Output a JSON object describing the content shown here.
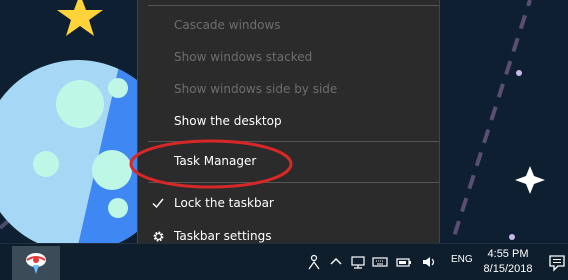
{
  "context_menu": {
    "items": [
      {
        "label": "Cascade windows",
        "enabled": false
      },
      {
        "label": "Show windows stacked",
        "enabled": false
      },
      {
        "label": "Show windows side by side",
        "enabled": false
      },
      {
        "label": "Show the desktop",
        "enabled": true
      },
      {
        "label": "Task Manager",
        "enabled": true,
        "highlighted": true
      },
      {
        "label": "Lock the taskbar",
        "enabled": true,
        "checked": true,
        "icon": "checkmark-icon"
      },
      {
        "label": "Taskbar settings",
        "enabled": true,
        "icon": "gear-icon"
      }
    ]
  },
  "taskbar": {
    "pinned_app_icon": "app-icon",
    "language": "ENG",
    "clock": {
      "time": "4:55 PM",
      "date": "8/15/2018"
    },
    "tray_icons": [
      "person-icon",
      "chevron-up-icon",
      "network-icon",
      "keyboard-icon",
      "battery-icon",
      "volume-icon"
    ],
    "notification_icon": "notification-icon"
  },
  "colors": {
    "menu_background": "#2b2b2b",
    "highlight_ring": "#d62828",
    "taskbar": "#0f1e2c",
    "wallpaper": "#0d1f30"
  }
}
